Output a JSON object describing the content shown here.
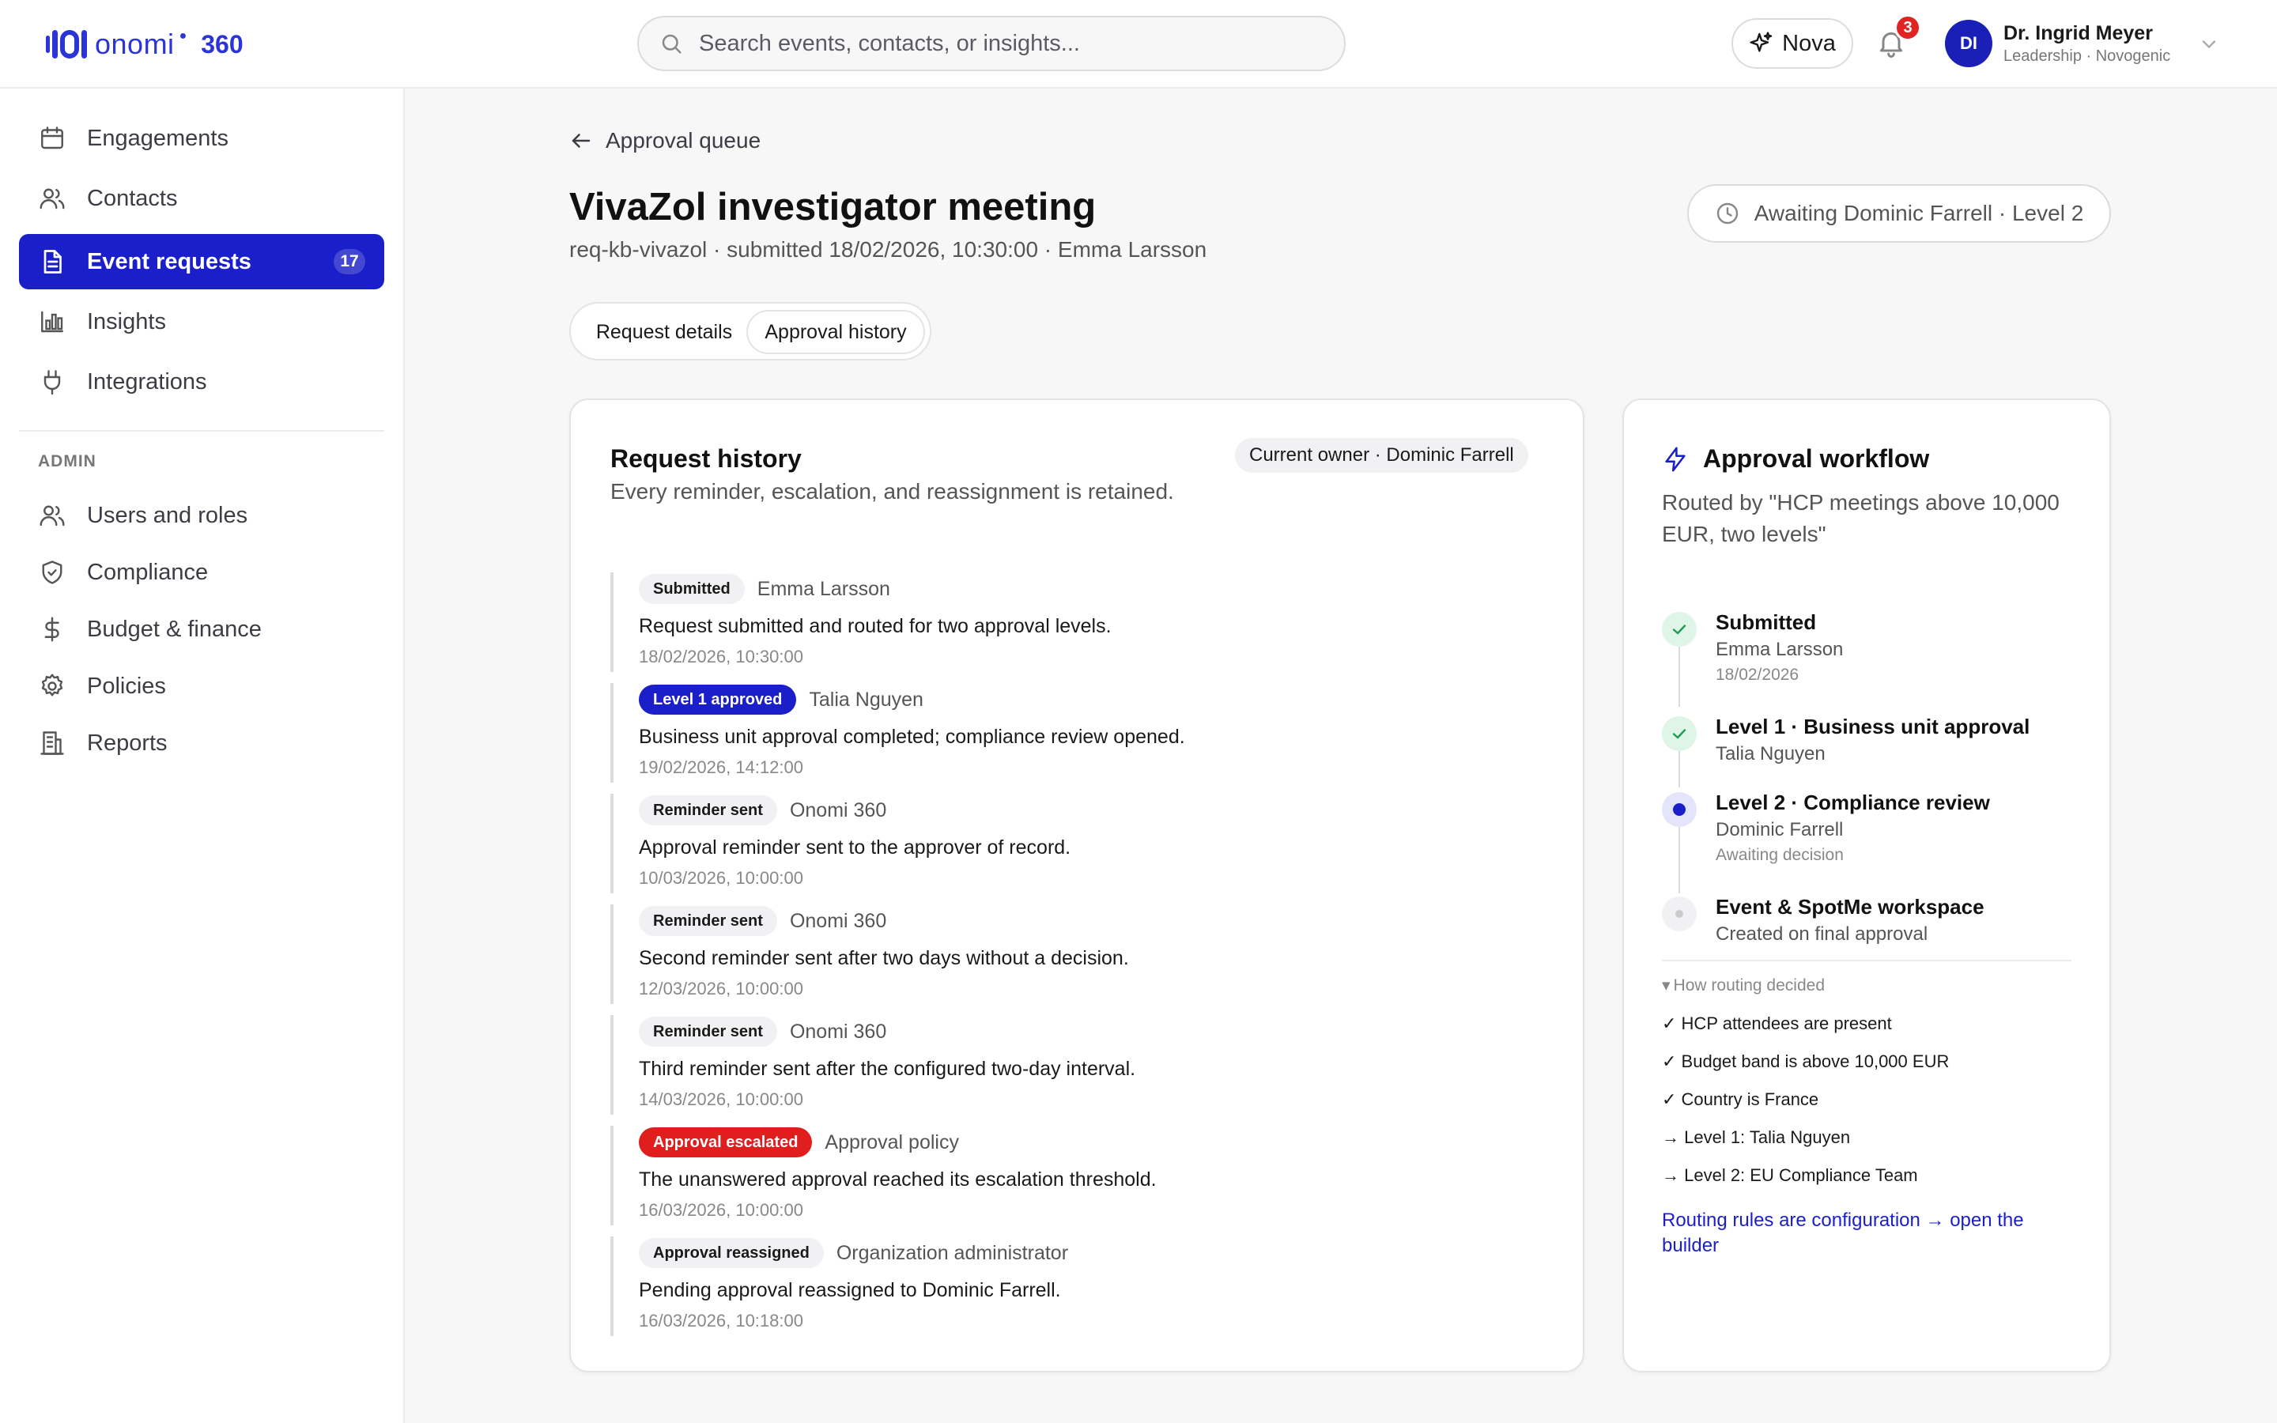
{
  "app": {
    "logo_text": "onomi",
    "logo_suffix": "360",
    "brand_color": "#2b34d6",
    "accent_color": "#1a1fc9"
  },
  "header": {
    "search_placeholder": "Search events, contacts, or insights...",
    "assistant_label": "Nova",
    "notifications_count": "3",
    "user_initials": "DI",
    "user_name": "Dr. Ingrid Meyer",
    "user_role": "Leadership · Novogenic"
  },
  "sidebar": {
    "items": [
      {
        "label": "Engagements",
        "icon": "calendar-icon"
      },
      {
        "label": "Contacts",
        "icon": "users-icon"
      },
      {
        "label": "Event requests",
        "icon": "document-icon",
        "count": "17",
        "active": true
      },
      {
        "label": "Insights",
        "icon": "bar-chart-icon"
      },
      {
        "label": "Integrations",
        "icon": "plug-icon"
      }
    ],
    "admin_label": "ADMIN",
    "admin_items": [
      {
        "label": "Users and roles",
        "icon": "users-icon"
      },
      {
        "label": "Compliance",
        "icon": "shield-icon"
      },
      {
        "label": "Budget & finance",
        "icon": "dollar-icon"
      },
      {
        "label": "Policies",
        "icon": "gear-icon"
      },
      {
        "label": "Reports",
        "icon": "building-icon"
      }
    ]
  },
  "page": {
    "back_label": "Approval queue",
    "title": "VivaZol investigator meeting",
    "subtitle": "req-kb-vivazol · submitted 18/02/2026, 10:30:00 · Emma Larsson",
    "status": "Awaiting Dominic Farrell · Level 2",
    "tabs": [
      {
        "label": "Request details",
        "selected": false
      },
      {
        "label": "Approval history",
        "selected": true
      }
    ]
  },
  "history": {
    "title": "Request history",
    "subtitle": "Every reminder, escalation, and reassignment is retained.",
    "owner": "Current owner · Dominic Farrell",
    "events": [
      {
        "tag": "Submitted",
        "style": "neutral",
        "actor": "Emma Larsson",
        "message": "Request submitted and routed for two approval levels.",
        "time": "18/02/2026, 10:30:00"
      },
      {
        "tag": "Level 1 approved",
        "style": "blue",
        "actor": "Talia Nguyen",
        "message": "Business unit approval completed; compliance review opened.",
        "time": "19/02/2026, 14:12:00"
      },
      {
        "tag": "Reminder sent",
        "style": "neutral",
        "actor": "Onomi 360",
        "message": "Approval reminder sent to the approver of record.",
        "time": "10/03/2026, 10:00:00"
      },
      {
        "tag": "Reminder sent",
        "style": "neutral",
        "actor": "Onomi 360",
        "message": "Second reminder sent after two days without a decision.",
        "time": "12/03/2026, 10:00:00"
      },
      {
        "tag": "Reminder sent",
        "style": "neutral",
        "actor": "Onomi 360",
        "message": "Third reminder sent after the configured two-day interval.",
        "time": "14/03/2026, 10:00:00"
      },
      {
        "tag": "Approval escalated",
        "style": "red",
        "actor": "Approval policy",
        "message": "The unanswered approval reached its escalation threshold.",
        "time": "16/03/2026, 10:00:00"
      },
      {
        "tag": "Approval reassigned",
        "style": "neutral",
        "actor": "Organization administrator",
        "message": "Pending approval reassigned to Dominic Farrell.",
        "time": "16/03/2026, 10:18:00"
      }
    ]
  },
  "workflow": {
    "title": "Approval workflow",
    "description": "Routed by \"HCP meetings above 10,000 EUR, two levels\"",
    "steps": [
      {
        "title": "Submitted",
        "sub": "Emma Larsson",
        "note": "18/02/2026",
        "state": "done"
      },
      {
        "title": "Level 1 · Business unit approval",
        "sub": "Talia Nguyen",
        "note": "",
        "state": "done"
      },
      {
        "title": "Level 2 · Compliance review",
        "sub": "Dominic Farrell",
        "note": "Awaiting decision",
        "state": "current"
      },
      {
        "title": "Event & SpotMe workspace",
        "sub": "Created on final approval",
        "note": "",
        "state": "pending"
      }
    ],
    "routing_summary": "How routing decided",
    "rules": [
      "✓ HCP attendees are present",
      "✓ Budget band is above 10,000 EUR",
      "✓ Country is France",
      "→ Level 1: Talia Nguyen",
      "→ Level 2: EU Compliance Team"
    ],
    "builder_link": "Routing rules are configuration → open the builder"
  }
}
